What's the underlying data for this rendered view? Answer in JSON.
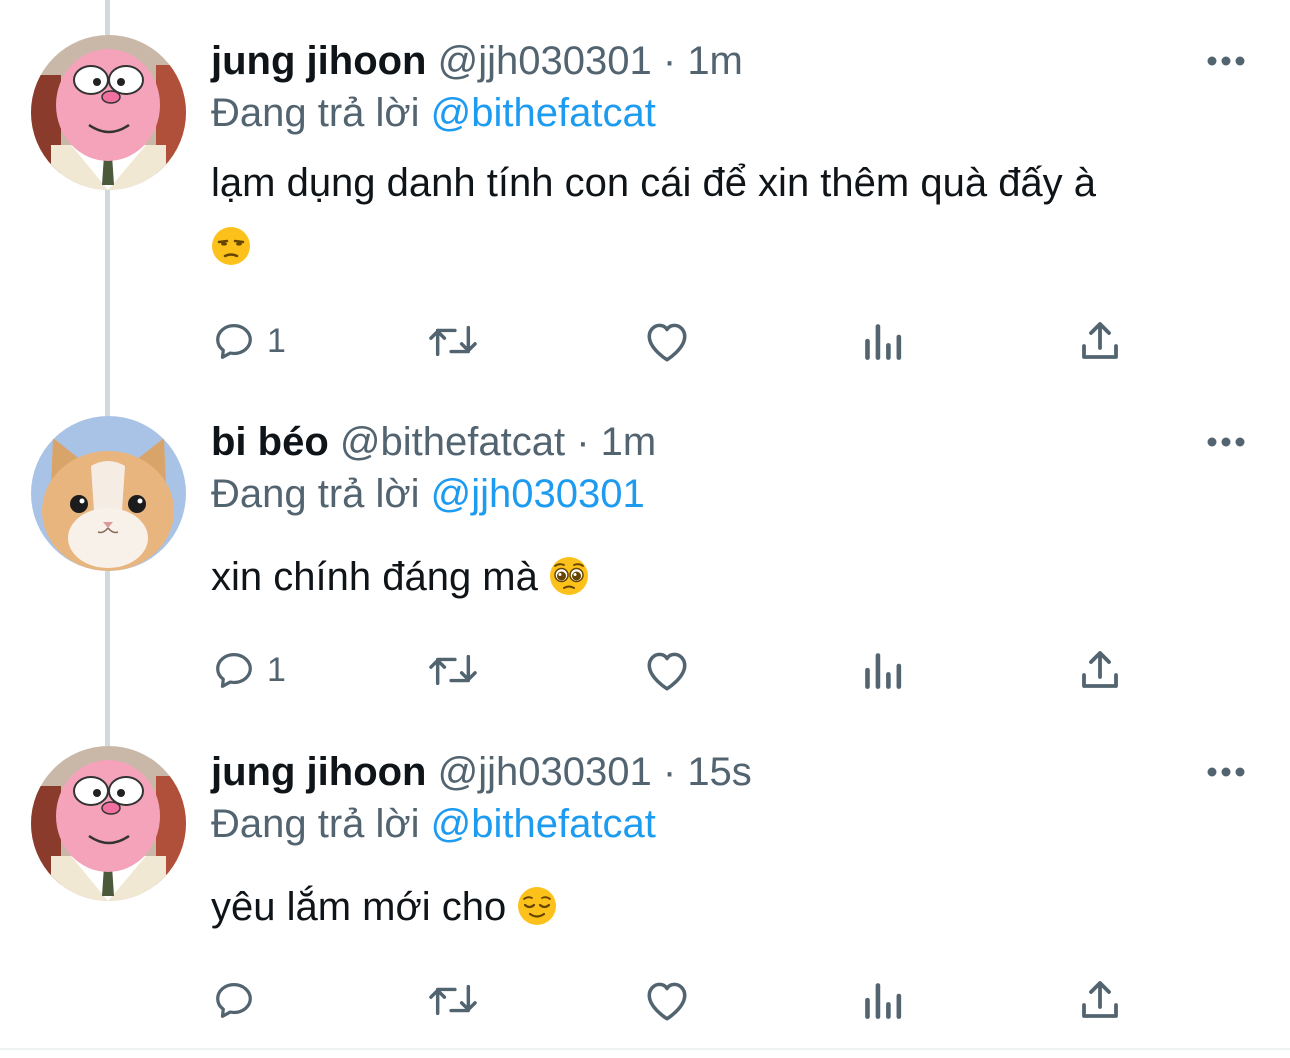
{
  "colors": {
    "text": "#0f1419",
    "secondary": "#536471",
    "link": "#1d9bf0",
    "thread_line": "#cfd9de"
  },
  "tweets": [
    {
      "display_name": "jung jihoon",
      "handle": "@jjh030301",
      "separator": "·",
      "time": "1m",
      "reply_prefix": "Đang trả lời",
      "reply_to": "@bithefatcat",
      "text_line1": "lạm dụng danh tính con cái để xin thêm quà đấy à",
      "text_line2": "",
      "emoji": "unamused-face",
      "avatar": "pink-cartoon-avatar",
      "reply_count": "1",
      "more_icon": "more-icon"
    },
    {
      "display_name": "bi béo",
      "handle": "@bithefatcat",
      "separator": "·",
      "time": "1m",
      "reply_prefix": "Đang trả lời",
      "reply_to": "@jjh030301",
      "text": "xin chính đáng mà",
      "emoji": "pleading-face",
      "avatar": "cat-photo-avatar",
      "reply_count": "1",
      "more_icon": "more-icon"
    },
    {
      "display_name": "jung jihoon",
      "handle": "@jjh030301",
      "separator": "·",
      "time": "15s",
      "reply_prefix": "Đang trả lời",
      "reply_to": "@bithefatcat",
      "text": "yêu lắm mới cho",
      "emoji": "relieved-face",
      "avatar": "pink-cartoon-avatar",
      "reply_count": "",
      "more_icon": "more-icon"
    }
  ],
  "action_icons": [
    "reply-icon",
    "retweet-icon",
    "like-icon",
    "views-icon",
    "share-icon"
  ]
}
